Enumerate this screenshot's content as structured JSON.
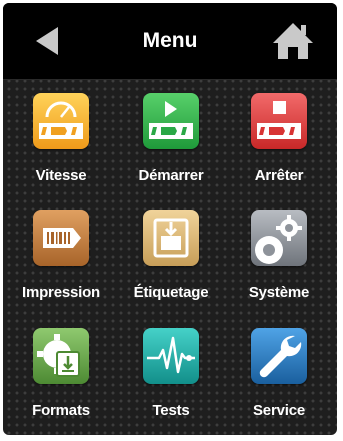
{
  "header": {
    "title": "Menu",
    "back_icon": "back-triangle-icon",
    "home_icon": "home-icon"
  },
  "colors": {
    "header_bg": "#000000",
    "background": "#1e1e1e",
    "label": "#ffffff",
    "vitesse": "#f5a623",
    "demarrer": "#2fae4a",
    "arreter": "#e23b3b",
    "impression": "#c07a3a",
    "etiquetage": "#d8b77a",
    "systeme": "#8e939a",
    "formats": "#6aa84f",
    "tests": "#1fb3ad",
    "service": "#2b7fc6"
  },
  "menu": {
    "items": [
      {
        "label": "Vitesse",
        "icon": "speedometer-icon"
      },
      {
        "label": "Démarrer",
        "icon": "play-icon"
      },
      {
        "label": "Arrêter",
        "icon": "stop-icon"
      },
      {
        "label": "Impression",
        "icon": "barcode-label-icon"
      },
      {
        "label": "Étiquetage",
        "icon": "label-applicator-icon"
      },
      {
        "label": "Système",
        "icon": "gears-icon"
      },
      {
        "label": "Formats",
        "icon": "gear-document-icon"
      },
      {
        "label": "Tests",
        "icon": "heartbeat-icon"
      },
      {
        "label": "Service",
        "icon": "wrench-icon"
      }
    ]
  }
}
